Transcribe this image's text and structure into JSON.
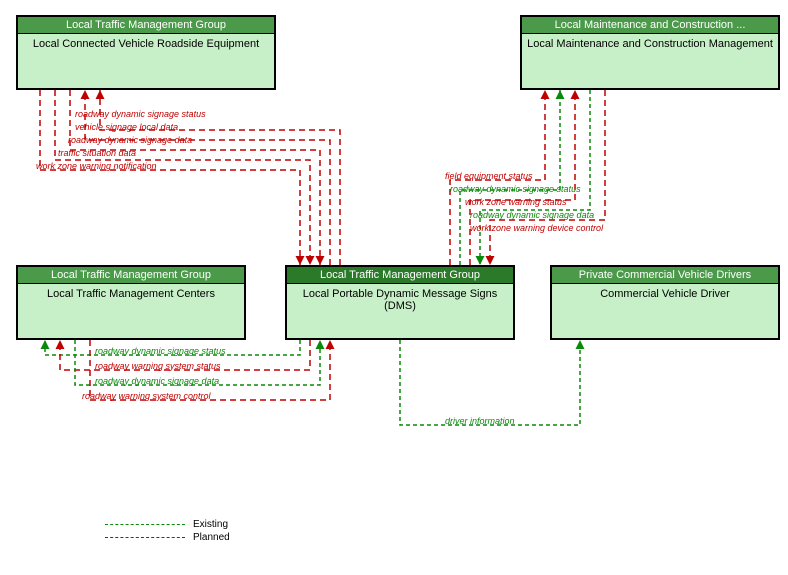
{
  "nodes": {
    "crv": {
      "header": "Local Traffic Management Group",
      "body": "Local Connected Vehicle Roadside Equipment"
    },
    "mcm": {
      "header": "Local Maintenance and Construction ...",
      "body": "Local Maintenance and Construction Management"
    },
    "tmc": {
      "header": "Local Traffic Management Group",
      "body": "Local Traffic Management Centers"
    },
    "dms": {
      "header": "Local Traffic Management Group",
      "body": "Local Portable Dynamic Message Signs (DMS)"
    },
    "cvd": {
      "header": "Private Commercial Vehicle Drivers",
      "body": "Commercial Vehicle Driver"
    }
  },
  "flows": {
    "crv_g1": "roadway dynamic signage status",
    "crv_g2": "vehicle signage local data",
    "crv_g3": "roadway dynamic signage data",
    "crv_g4": "traffic situation data",
    "crv_g5": "work zone warning notification",
    "mcm_g1": "field equipment status",
    "mcm_g2": "roadway dynamic signage status",
    "mcm_g3": "work zone warning status",
    "mcm_g4": "roadway dynamic signage data",
    "mcm_g5": "work zone warning device control",
    "tmc_g1": "roadway dynamic signage status",
    "tmc_g2": "roadway warning system status",
    "tmc_g3": "roadway dynamic signage data",
    "tmc_g4": "roadway warning system control",
    "cvd_g1": "driver information"
  },
  "legend": {
    "existing": "Existing",
    "planned": "Planned"
  },
  "colors": {
    "existing": "#0a8a0a",
    "planned": "#c00000"
  },
  "chart_data": {
    "type": "diagram",
    "title": "Local Portable Dynamic Message Signs (DMS) context diagram",
    "nodes": [
      {
        "id": "crv",
        "group": "Local Traffic Management Group",
        "label": "Local Connected Vehicle Roadside Equipment"
      },
      {
        "id": "mcm",
        "group": "Local Maintenance and Construction ...",
        "label": "Local Maintenance and Construction Management"
      },
      {
        "id": "tmc",
        "group": "Local Traffic Management Group",
        "label": "Local Traffic Management Centers"
      },
      {
        "id": "dms",
        "group": "Local Traffic Management Group",
        "label": "Local Portable Dynamic Message Signs (DMS)"
      },
      {
        "id": "cvd",
        "group": "Private Commercial Vehicle Drivers",
        "label": "Commercial Vehicle Driver"
      }
    ],
    "edges": [
      {
        "from": "dms",
        "to": "crv",
        "label": "roadway dynamic signage status",
        "status": "planned"
      },
      {
        "from": "crv",
        "to": "dms",
        "label": "vehicle signage local data",
        "status": "planned"
      },
      {
        "from": "crv",
        "to": "dms",
        "label": "roadway dynamic signage data",
        "status": "planned"
      },
      {
        "from": "crv",
        "to": "dms",
        "label": "traffic situation data",
        "status": "planned"
      },
      {
        "from": "crv",
        "to": "dms",
        "label": "work zone warning notification",
        "status": "planned"
      },
      {
        "from": "dms",
        "to": "mcm",
        "label": "field equipment status",
        "status": "planned"
      },
      {
        "from": "dms",
        "to": "mcm",
        "label": "roadway dynamic signage status",
        "status": "existing"
      },
      {
        "from": "dms",
        "to": "mcm",
        "label": "work zone warning status",
        "status": "planned"
      },
      {
        "from": "mcm",
        "to": "dms",
        "label": "roadway dynamic signage data",
        "status": "existing"
      },
      {
        "from": "mcm",
        "to": "dms",
        "label": "work zone warning device control",
        "status": "planned"
      },
      {
        "from": "dms",
        "to": "tmc",
        "label": "roadway dynamic signage status",
        "status": "existing"
      },
      {
        "from": "dms",
        "to": "tmc",
        "label": "roadway warning system status",
        "status": "planned"
      },
      {
        "from": "tmc",
        "to": "dms",
        "label": "roadway dynamic signage data",
        "status": "existing"
      },
      {
        "from": "tmc",
        "to": "dms",
        "label": "roadway warning system control",
        "status": "planned"
      },
      {
        "from": "dms",
        "to": "cvd",
        "label": "driver information",
        "status": "existing"
      }
    ]
  }
}
